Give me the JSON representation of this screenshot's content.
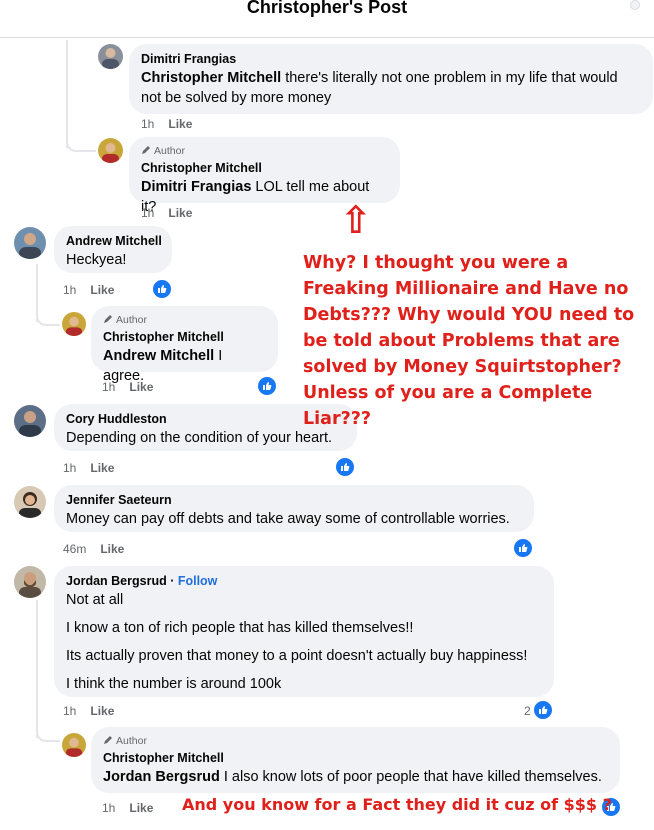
{
  "header": {
    "title": "Christopher's Post"
  },
  "comments": [
    {
      "name": "Dimitri Frangias",
      "mention": "Christopher Mitchell",
      "text": " there's literally not one problem in my life that would not be solved by more money",
      "time": "1h",
      "like": "Like"
    },
    {
      "author_badge": "Author",
      "name": "Christopher Mitchell",
      "mention": "Dimitri Frangias",
      "text": " LOL tell me about it?",
      "time": "1h",
      "like": "Like"
    },
    {
      "name": "Andrew Mitchell",
      "text": "Heckyea!",
      "time": "1h",
      "like": "Like"
    },
    {
      "author_badge": "Author",
      "name": "Christopher Mitchell",
      "mention": "Andrew Mitchell",
      "text": " I agree.",
      "time": "1h",
      "like": "Like"
    },
    {
      "name": "Cory Huddleston",
      "text": "Depending on the condition of your heart.",
      "time": "1h",
      "like": "Like"
    },
    {
      "name": "Jennifer Saeteurn",
      "text": "Money can pay off debts and take away some of controllable worries.",
      "time": "46m",
      "like": "Like"
    },
    {
      "name": "Jordan Bergsrud",
      "follow": "Follow",
      "paragraphs": [
        "Not at all",
        "I know a ton of rich people that has killed themselves!!",
        "Its actually proven that money to a point doesn't actually buy happiness!",
        "I think the number is around 100k"
      ],
      "time": "1h",
      "like": "Like",
      "reaction_count": "2"
    },
    {
      "author_badge": "Author",
      "name": "Christopher Mitchell",
      "mention": "Jordan Bergsrud",
      "text": " I also know lots of poor people that have killed themselves.",
      "time": "1h",
      "like": "Like"
    }
  ],
  "annotations": {
    "arrow": "⇧",
    "main": "Why? I thought you were a Freaking Millionaire and Have no Debts??? Why would YOU need to be told about Problems that are solved by Money Squirtstopher? Unless of you are a Complete Liar???",
    "bottom": "And you know for a Fact they did it cuz of $$$ ?",
    "color": "#e0201a"
  },
  "colors": {
    "bubble": "#f0f2f5",
    "like_blue": "#1877f2",
    "meta": "#65676b",
    "follow": "#216fdb"
  },
  "icons": [
    "like-thumb-icon",
    "pencil-icon",
    "avatar"
  ]
}
